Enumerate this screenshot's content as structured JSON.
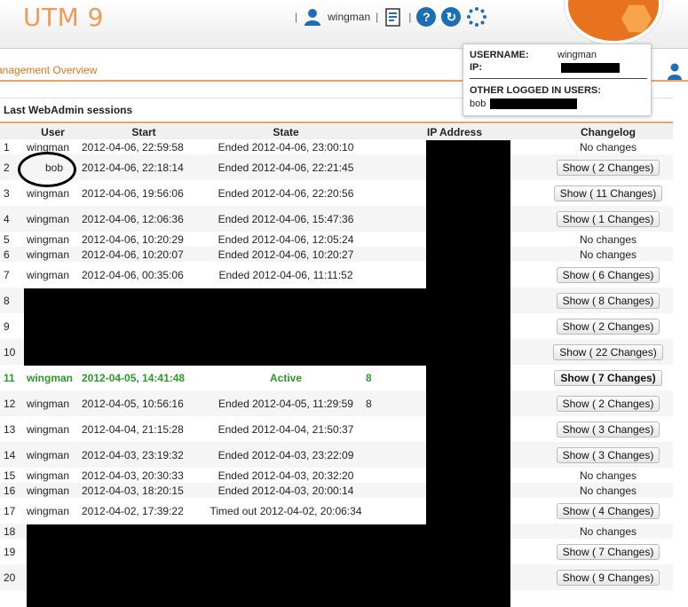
{
  "app": {
    "title": "UTM 9"
  },
  "header": {
    "username": "wingman",
    "icons": [
      "user-icon",
      "notes-icon",
      "help-icon",
      "refresh-icon",
      "loading-icon"
    ]
  },
  "subbar": {
    "title": "anagement Overview"
  },
  "popup": {
    "username_label": "USERNAME:",
    "username_value": "wingman",
    "ip_label": "IP:",
    "others_label": "OTHER LOGGED IN USERS:",
    "others_value": "bob"
  },
  "sessions": {
    "title": "Last WebAdmin sessions",
    "columns": [
      "User",
      "Start",
      "State",
      "IP Address",
      "Changelog"
    ],
    "rows": [
      {
        "n": "1",
        "user": "wingman",
        "start": "2012-04-06, 22:59:58",
        "state": "Ended 2012-04-06, 23:00:10",
        "ip": "",
        "changelog": "No changes",
        "button": false
      },
      {
        "n": "2",
        "user": "bob",
        "start": "2012-04-06, 22:18:14",
        "state": "Ended 2012-04-06, 22:21:45",
        "ip": "",
        "changelog": "Show ( 2 Changes)",
        "button": true
      },
      {
        "n": "3",
        "user": "wingman",
        "start": "2012-04-06, 19:56:06",
        "state": "Ended 2012-04-06, 22:20:56",
        "ip": "",
        "changelog": "Show ( 11 Changes)",
        "button": true
      },
      {
        "n": "4",
        "user": "wingman",
        "start": "2012-04-06, 12:06:36",
        "state": "Ended 2012-04-06, 15:47:36",
        "ip": "",
        "changelog": "Show ( 1 Changes)",
        "button": true
      },
      {
        "n": "5",
        "user": "wingman",
        "start": "2012-04-06, 10:20:29",
        "state": "Ended 2012-04-06, 12:05:24",
        "ip": "",
        "changelog": "No changes",
        "button": false
      },
      {
        "n": "6",
        "user": "wingman",
        "start": "2012-04-06, 10:20:07",
        "state": "Ended 2012-04-06, 10:20:27",
        "ip": "",
        "changelog": "No changes",
        "button": false
      },
      {
        "n": "7",
        "user": "wingman",
        "start": "2012-04-06, 00:35:06",
        "state": "Ended 2012-04-06, 11:11:52",
        "ip": "",
        "changelog": "Show ( 6 Changes)",
        "button": true
      },
      {
        "n": "8",
        "user": "",
        "start": "",
        "state": "",
        "ip": "",
        "changelog": "Show ( 8 Changes)",
        "button": true
      },
      {
        "n": "9",
        "user": "",
        "start": "",
        "state": "",
        "ip": "",
        "changelog": "Show ( 2 Changes)",
        "button": true
      },
      {
        "n": "10",
        "user": "",
        "start": "",
        "state": "",
        "ip": "",
        "changelog": "Show ( 22 Changes)",
        "button": true
      },
      {
        "n": "11",
        "user": "wingman",
        "start": "2012-04-05, 14:41:48",
        "state": "Active",
        "ip": "8",
        "changelog": "Show ( 7 Changes)",
        "button": true,
        "active": true
      },
      {
        "n": "12",
        "user": "wingman",
        "start": "2012-04-05, 10:56:16",
        "state": "Ended 2012-04-05, 11:29:59",
        "ip": "8",
        "changelog": "Show ( 2 Changes)",
        "button": true
      },
      {
        "n": "13",
        "user": "wingman",
        "start": "2012-04-04, 21:15:28",
        "state": "Ended 2012-04-04, 21:50:37",
        "ip": "",
        "changelog": "Show ( 3 Changes)",
        "button": true
      },
      {
        "n": "14",
        "user": "wingman",
        "start": "2012-04-03, 23:19:32",
        "state": "Ended 2012-04-03, 23:22:09",
        "ip": "",
        "changelog": "Show ( 3 Changes)",
        "button": true
      },
      {
        "n": "15",
        "user": "wingman",
        "start": "2012-04-03, 20:30:33",
        "state": "Ended 2012-04-03, 20:32:20",
        "ip": "",
        "changelog": "No changes",
        "button": false
      },
      {
        "n": "16",
        "user": "wingman",
        "start": "2012-04-03, 18:20:15",
        "state": "Ended 2012-04-03, 20:00:14",
        "ip": "",
        "changelog": "No changes",
        "button": false
      },
      {
        "n": "17",
        "user": "wingman",
        "start": "2012-04-02, 17:39:22",
        "state": "Timed out 2012-04-02, 20:06:34",
        "ip": "",
        "changelog": "Show ( 4 Changes)",
        "button": true
      },
      {
        "n": "18",
        "user": "",
        "start": "",
        "state": "",
        "ip": "",
        "changelog": "No changes",
        "button": false
      },
      {
        "n": "19",
        "user": "",
        "start": "",
        "state": "",
        "ip": "",
        "changelog": "Show ( 7 Changes)",
        "button": true
      },
      {
        "n": "20",
        "user": "",
        "start": "",
        "state": "",
        "ip": "",
        "changelog": "Show ( 9 Changes)",
        "button": true
      }
    ]
  },
  "colors": {
    "accent": "#f29a55",
    "active": "#2a9b2a",
    "brand_orange": "#e8731f"
  }
}
